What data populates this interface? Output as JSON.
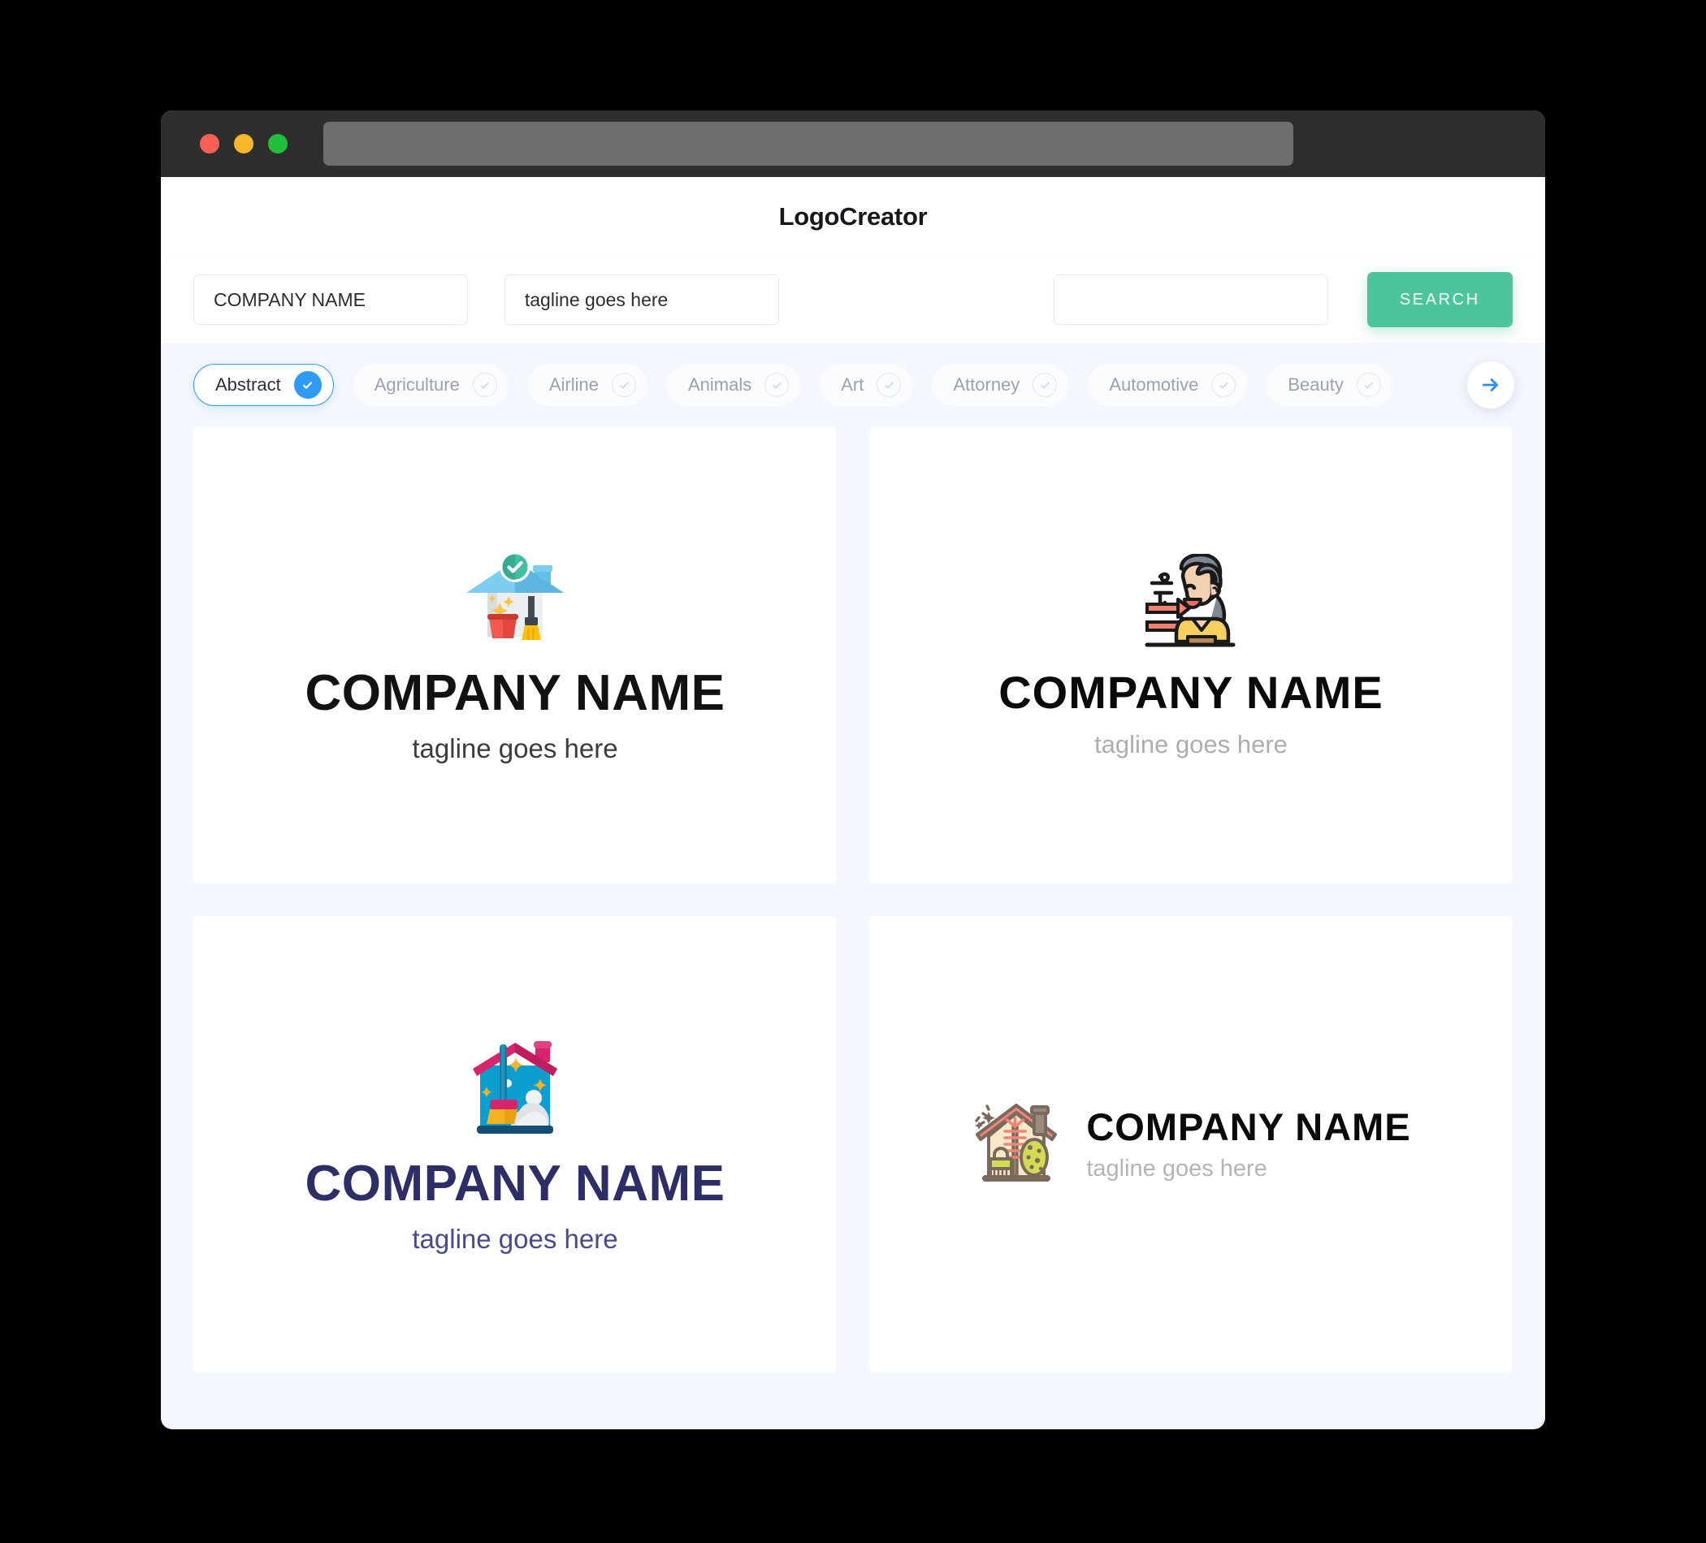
{
  "window": {
    "titlebar": {
      "lights": [
        "close-red",
        "minimize-yellow",
        "maximize-green"
      ],
      "url_value": ""
    }
  },
  "header": {
    "title": "LogoCreator"
  },
  "search": {
    "company_value": "COMPANY NAME",
    "company_placeholder": "COMPANY NAME",
    "tagline_value": "tagline goes here",
    "tagline_placeholder": "tagline goes here",
    "keyword_value": "",
    "keyword_placeholder": "",
    "button_label": "SEARCH",
    "button_color": "#4cc59b"
  },
  "categories": {
    "selected": "Abstract",
    "next_arrow_icon": "arrow-right-icon",
    "accent_color": "#2f9bf5",
    "items": [
      {
        "label": "Abstract",
        "selected": true
      },
      {
        "label": "Agriculture",
        "selected": false
      },
      {
        "label": "Airline",
        "selected": false
      },
      {
        "label": "Animals",
        "selected": false
      },
      {
        "label": "Art",
        "selected": false
      },
      {
        "label": "Attorney",
        "selected": false
      },
      {
        "label": "Automotive",
        "selected": false
      },
      {
        "label": "Beauty",
        "selected": false
      }
    ]
  },
  "results": {
    "cards": [
      {
        "icon": "house-check-bucket-broom-icon",
        "brand": "COMPANY NAME",
        "tagline": "tagline goes here",
        "layout": "stacked",
        "brand_color": "#121212",
        "tagline_color": "#3c3c3c"
      },
      {
        "icon": "woman-air-freshener-icon",
        "brand": "COMPANY NAME",
        "tagline": "tagline goes here",
        "layout": "stacked",
        "brand_color": "#0a0a0a",
        "tagline_color": "#adadad"
      },
      {
        "icon": "house-broom-sparkle-icon",
        "brand": "COMPANY NAME",
        "tagline": "tagline goes here",
        "layout": "stacked",
        "brand_color": "#2d2d68",
        "tagline_color": "#474a8c"
      },
      {
        "icon": "house-duster-sponge-brush-icon",
        "brand": "COMPANY NAME",
        "tagline": "tagline goes here",
        "layout": "horizontal",
        "brand_color": "#0a0a0a",
        "tagline_color": "#b5b5b5"
      }
    ]
  }
}
